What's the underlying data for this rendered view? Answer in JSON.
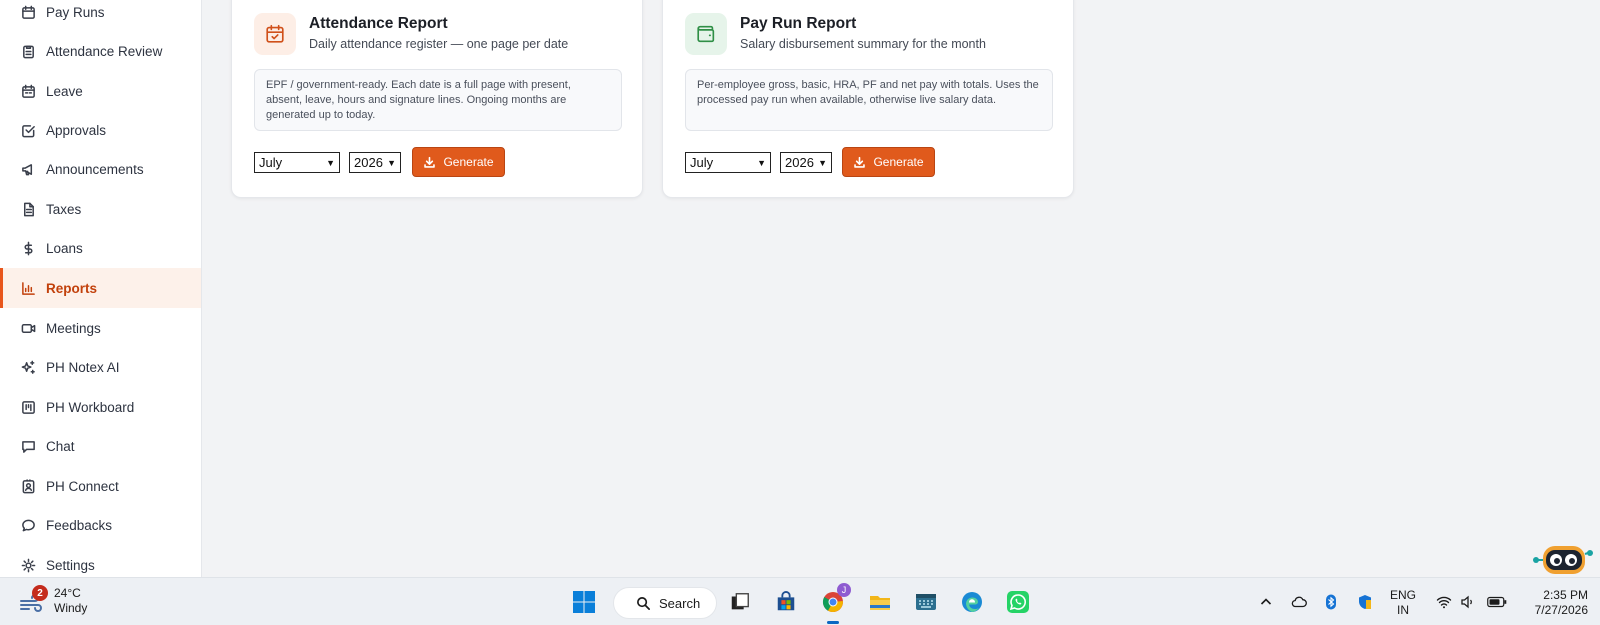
{
  "sidebar": {
    "items": [
      {
        "label": "Pay Runs",
        "icon": "calendar-icon"
      },
      {
        "label": "Attendance Review",
        "icon": "clipboard-icon"
      },
      {
        "label": "Leave",
        "icon": "calendar-icon"
      },
      {
        "label": "Approvals",
        "icon": "checkbox-icon"
      },
      {
        "label": "Announcements",
        "icon": "megaphone-icon"
      },
      {
        "label": "Taxes",
        "icon": "document-icon"
      },
      {
        "label": "Loans",
        "icon": "dollar-icon"
      },
      {
        "label": "Reports",
        "icon": "bar-chart-icon",
        "active": true
      },
      {
        "label": "Meetings",
        "icon": "video-icon"
      },
      {
        "label": "PH Notex AI",
        "icon": "sparkles-icon"
      },
      {
        "label": "PH Workboard",
        "icon": "kanban-icon"
      },
      {
        "label": "Chat",
        "icon": "chat-icon"
      },
      {
        "label": "PH Connect",
        "icon": "contact-card-icon"
      },
      {
        "label": "Feedbacks",
        "icon": "speech-bubble-icon"
      },
      {
        "label": "Settings",
        "icon": "gear-icon"
      }
    ]
  },
  "reports": [
    {
      "title": "Attendance Report",
      "subtitle": "Daily attendance register — one page per date",
      "description": "EPF / government-ready. Each date is a full page with present, absent, leave, hours and signature lines. Ongoing months are generated up to today.",
      "month": "July",
      "year": "2026",
      "button": "Generate",
      "icon": "calendar-check-icon",
      "accent": "#e05a1c"
    },
    {
      "title": "Pay Run Report",
      "subtitle": "Salary disbursement summary for the month",
      "description": "Per-employee gross, basic, HRA, PF and net pay with totals. Uses the processed pay run when available, otherwise live salary data.",
      "month": "July",
      "year": "2026",
      "button": "Generate",
      "icon": "wallet-icon",
      "accent": "#2f8f46"
    }
  ],
  "taskbar": {
    "weather_badge": "2",
    "temperature": "24°C",
    "condition": "Windy",
    "search_label": "Search",
    "chrome_profile": "J",
    "lang_line1": "ENG",
    "lang_line2": "IN",
    "time": "2:35 PM",
    "date": "7/27/2026"
  }
}
